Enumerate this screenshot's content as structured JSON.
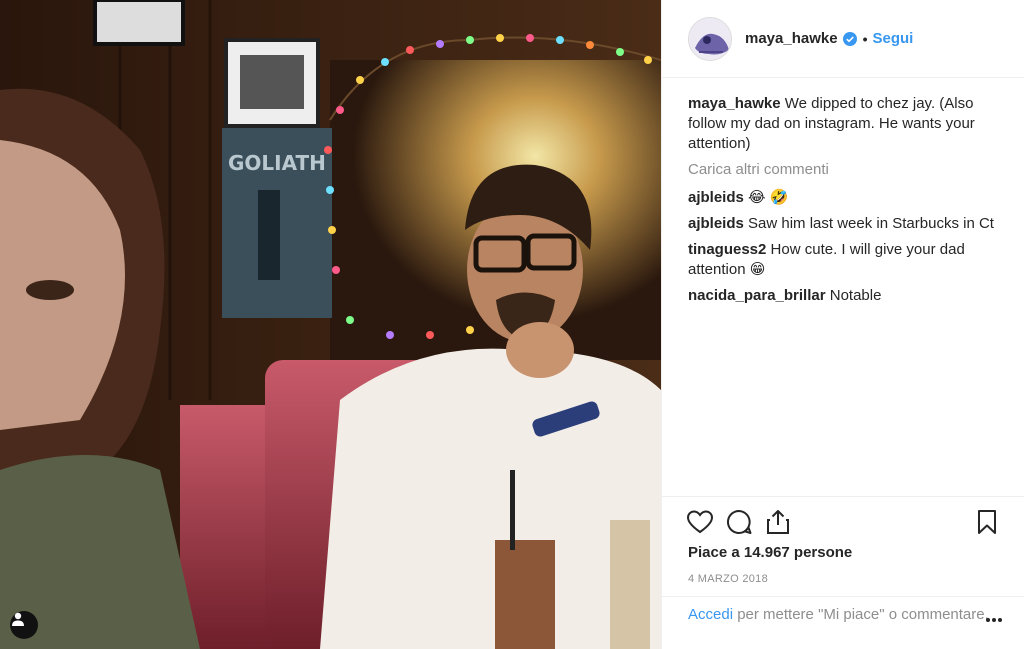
{
  "post": {
    "username": "maya_hawke",
    "follow_label": "Segui",
    "separator": "•",
    "caption_user": "maya_hawke",
    "caption_text": "We dipped to chez jay. (Also follow my dad on instagram. He wants your attention)",
    "load_more_label": "Carica altri commenti",
    "poster_text": "GOLIATH"
  },
  "comments": [
    {
      "user": "ajbleids",
      "text": "😂 🤣"
    },
    {
      "user": "ajbleids",
      "text": "Saw him last week in Starbucks in Ct"
    },
    {
      "user": "tinaguess2",
      "text": "How cute. I will give your dad attention 😁"
    },
    {
      "user": "nacida_para_brillar",
      "text": "Notable"
    }
  ],
  "footer": {
    "likes_text": "Piace a 14.967 persone",
    "date": "4 marzo 2018",
    "login_link": "Accedi",
    "login_text": " per mettere \"Mi piace\" o commentare."
  },
  "icons": {
    "user_tag": "user-tag-icon",
    "heart": "heart-icon",
    "comment": "comment-icon",
    "share": "share-icon",
    "bookmark": "bookmark-icon",
    "more": "more-options-icon",
    "verified": "verified-badge-icon"
  },
  "colors": {
    "accent": "#3897f0",
    "text": "#262626",
    "muted": "#8e8e8e",
    "border": "#efefef"
  }
}
